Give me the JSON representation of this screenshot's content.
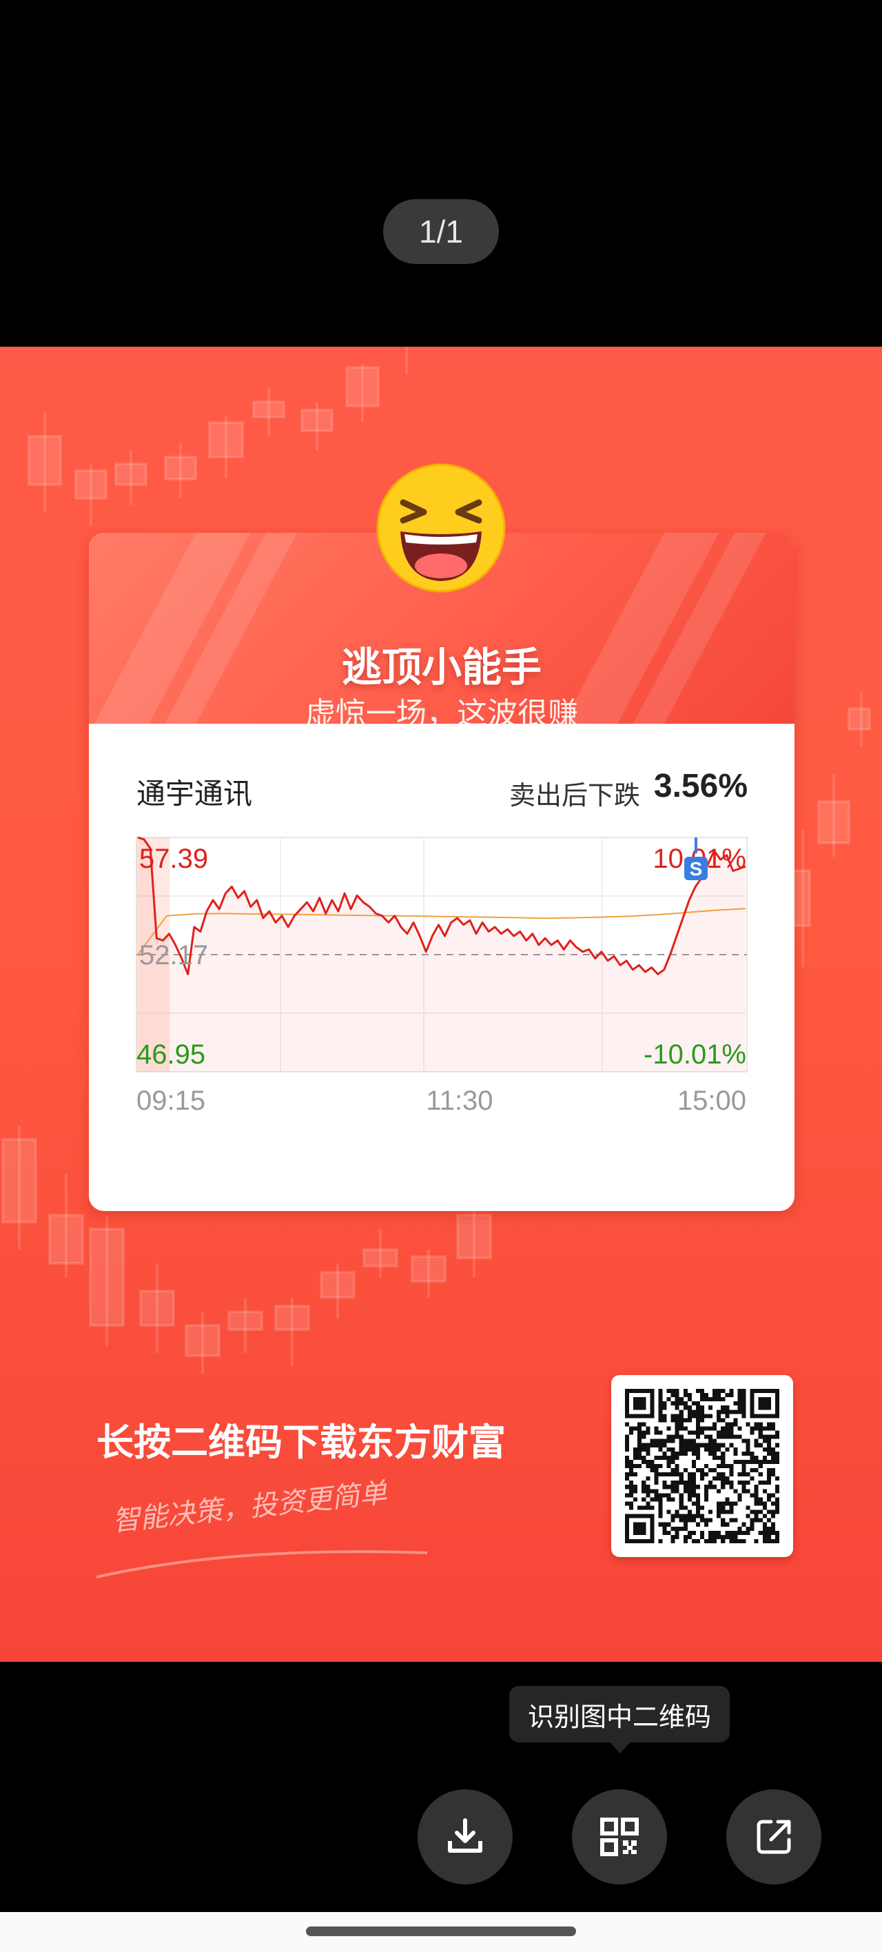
{
  "viewer": {
    "page_counter": "1/1",
    "tooltip": "识别图中二维码",
    "buttons": [
      {
        "name": "download",
        "icon": "download-icon"
      },
      {
        "name": "scan-qr",
        "icon": "qr-scan-icon"
      },
      {
        "name": "share",
        "icon": "share-icon"
      }
    ]
  },
  "poster": {
    "emoji": "laughing-face-icon",
    "title": "逃顶小能手",
    "subtitle": "虚惊一场，这波很赚",
    "stock_name": "通宇通讯",
    "sell_label": "卖出后下跌",
    "sell_value": "3.56%",
    "promo_title": "长按二维码下载东方财富",
    "promo_slogan": "智能决策，投资更简单",
    "colors": {
      "background": "#ff5a45",
      "price_up": "#e0201c",
      "price_down": "#2a9a1a",
      "avg_line": "#f0a040"
    }
  },
  "chart_data": {
    "type": "line",
    "title": "",
    "xlabel": "",
    "ylabel": "",
    "x_ticks": [
      "09:15",
      "11:30",
      "15:00"
    ],
    "ylim": [
      46.95,
      57.39
    ],
    "y_labels": {
      "top": "57.39",
      "mid": "52.17",
      "bottom": "46.95"
    },
    "pct_labels": {
      "top": "10.01%",
      "bottom": "-10.01%"
    },
    "reference_price": 52.17,
    "marker": "S",
    "series": [
      {
        "values": [
          57.39,
          57.3,
          56.9,
          52.9,
          52.8,
          53.1,
          52.6,
          52.0,
          51.3,
          53.4,
          53.2,
          54.1,
          54.6,
          54.2,
          54.9,
          55.2,
          54.7,
          55.0,
          54.3,
          54.6,
          53.8,
          54.1,
          53.6,
          53.9,
          53.4,
          53.9,
          54.2,
          54.5,
          54.1,
          54.7,
          54.0,
          54.6,
          54.1,
          54.9,
          54.2,
          54.8,
          54.5,
          54.3,
          54.0,
          53.9,
          53.6,
          53.9,
          53.4,
          53.1,
          53.6,
          53.0,
          52.3,
          53.0,
          53.5,
          53.0,
          53.6,
          53.8,
          53.5,
          53.7,
          53.1,
          53.6,
          53.2,
          53.4,
          53.1,
          53.3,
          53.0,
          53.2,
          52.8,
          53.1,
          52.6,
          52.9,
          52.6,
          52.8,
          52.4,
          52.8,
          52.5,
          52.3,
          52.4,
          52.0,
          52.3,
          51.9,
          52.1,
          51.7,
          51.9,
          51.5,
          51.7,
          51.4,
          51.6,
          51.3,
          51.5,
          52.2,
          53.0,
          53.8,
          54.6,
          55.2,
          55.6,
          56.2,
          56.8,
          56.4,
          56.6,
          55.9,
          56.0,
          56.1
        ]
      },
      {
        "values": [
          52.17,
          53.9,
          53.99,
          54.0,
          53.98,
          53.97,
          53.95,
          53.93,
          53.91,
          53.9,
          53.88,
          53.86,
          53.84,
          53.82,
          53.79,
          53.81,
          53.84,
          53.88,
          53.95,
          54.05,
          54.15,
          54.22
        ]
      }
    ]
  }
}
